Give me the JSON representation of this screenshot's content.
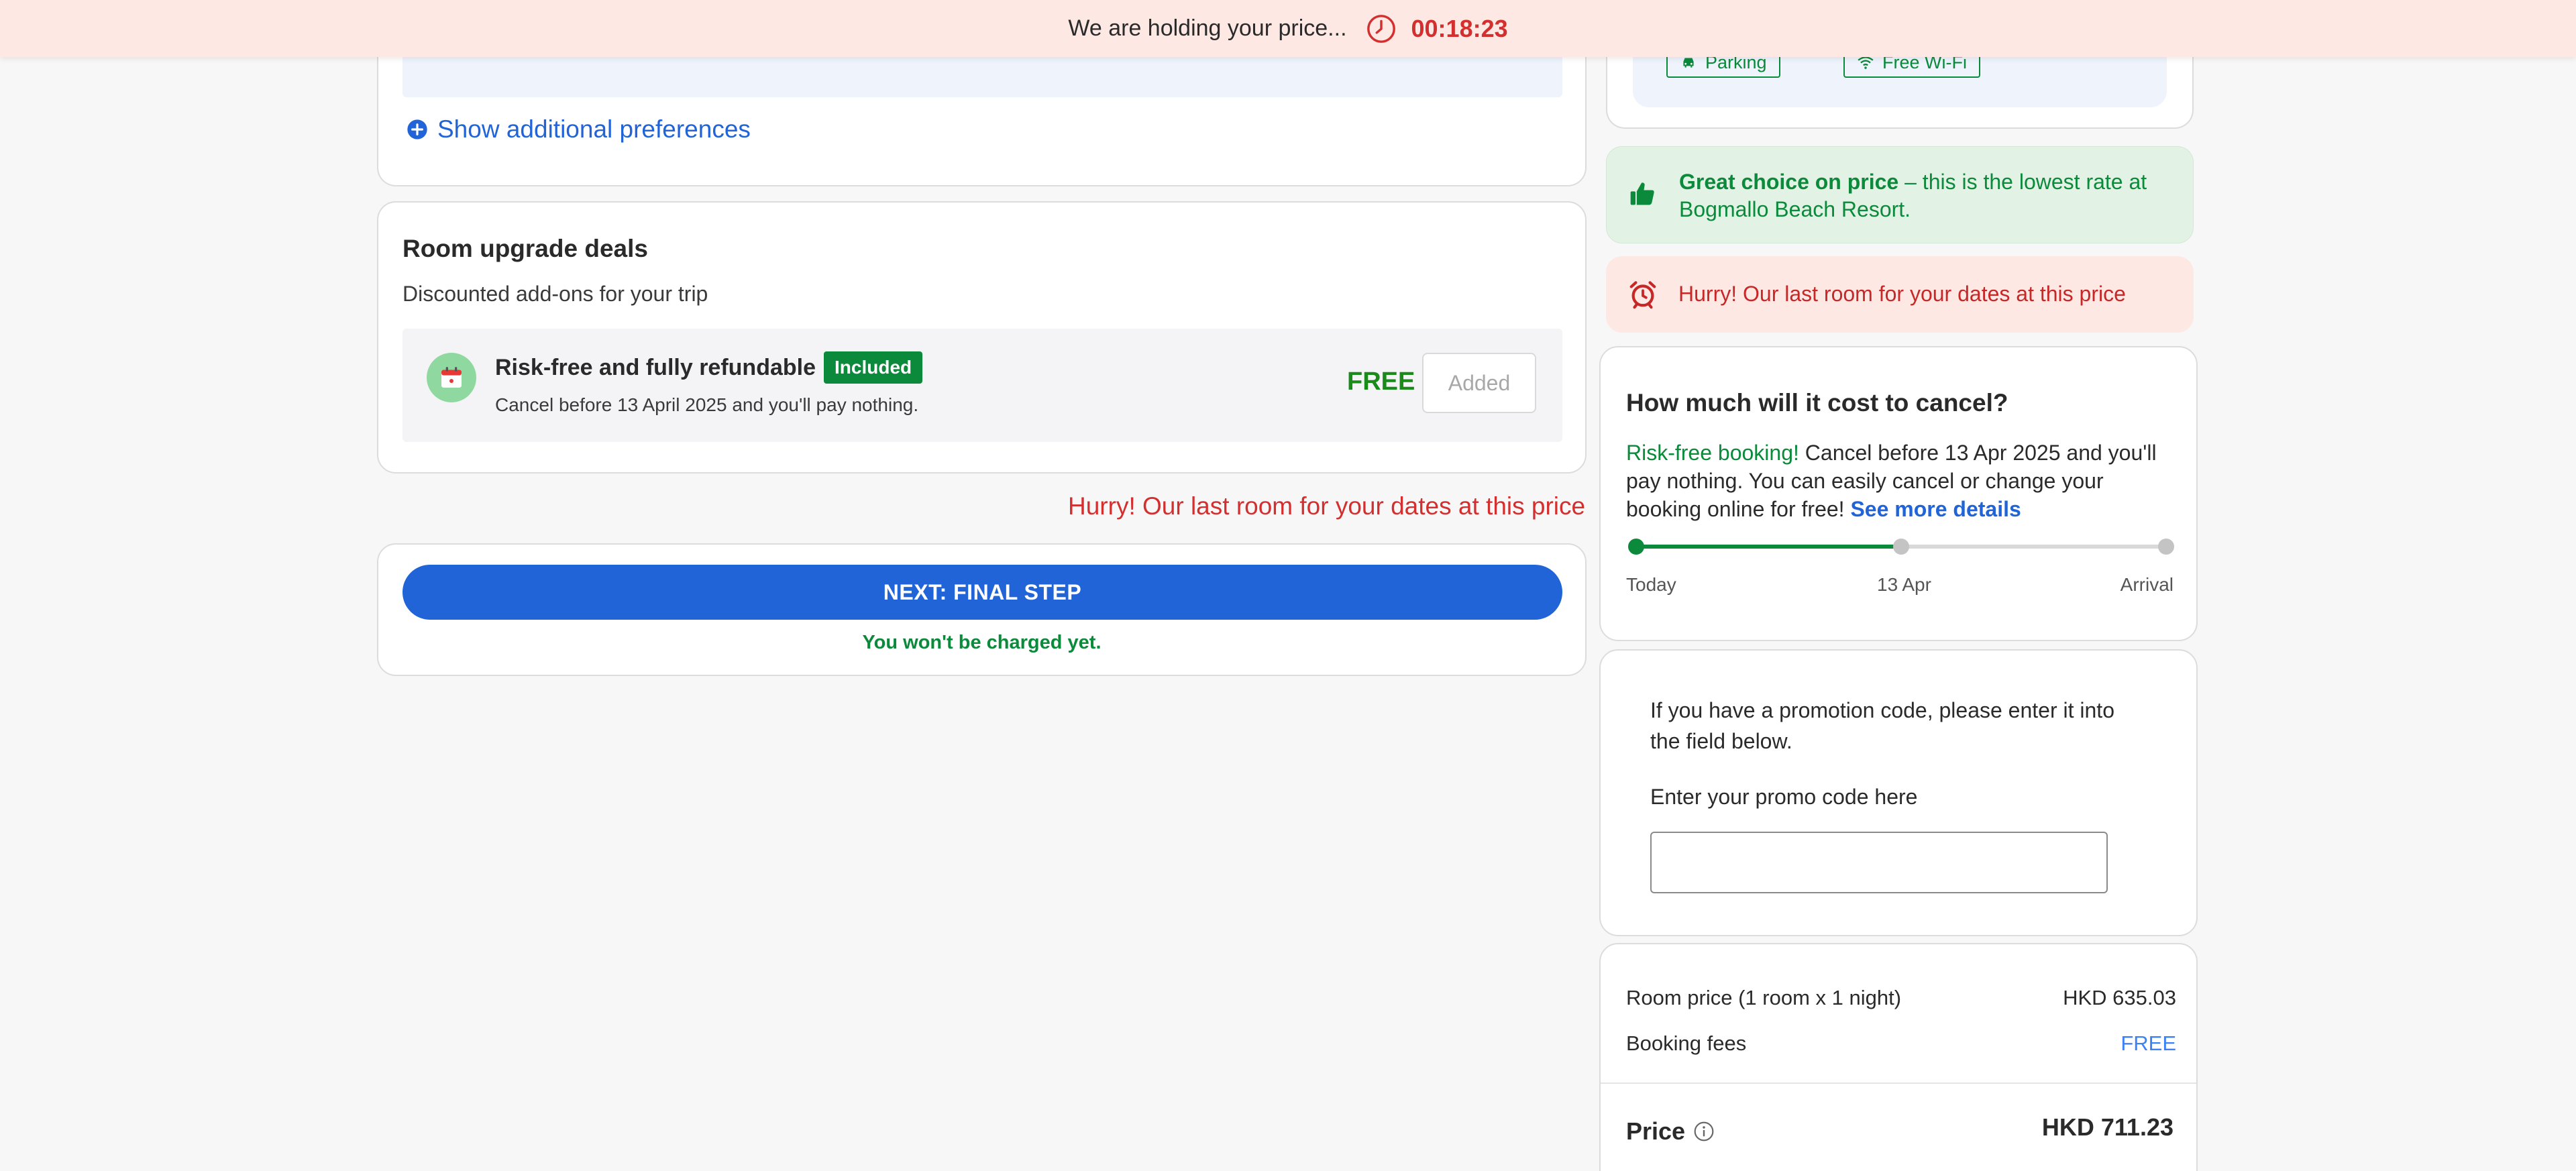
{
  "timer_bar": {
    "holding_text": "We are holding your price...",
    "countdown": "00:18:23"
  },
  "preferences": {
    "show_more_label": "Show additional preferences"
  },
  "upgrades": {
    "title": "Room upgrade deals",
    "subtitle": "Discounted add-ons for your trip",
    "item": {
      "title": "Risk-free and fully refundable",
      "badge": "Included",
      "description": "Cancel before 13 April 2025 and you'll pay nothing.",
      "price": "FREE",
      "button_label": "Added"
    }
  },
  "hurry_message": "Hurry! Our last room for your dates at this price",
  "next": {
    "button_label": "NEXT: FINAL STEP",
    "note": "You won't be charged yet."
  },
  "amenities": [
    "Parking",
    "Free Wi-Fi"
  ],
  "great_choice": {
    "bold": "Great choice on price",
    "text": " – this is the lowest rate at Bogmallo Beach Resort."
  },
  "cancellation": {
    "title": "How much will it cost to cancel?",
    "highlight": "Risk-free booking!",
    "text": " Cancel before 13 Apr 2025 and you'll pay nothing. You can easily cancel or change your booking online for free! ",
    "link": "See more details",
    "timeline": {
      "labels": [
        "Today",
        "13 Apr",
        "Arrival"
      ],
      "progress": 0.5
    }
  },
  "promo": {
    "text": "If you have a promotion code, please enter it into the field below.",
    "label": "Enter your promo code here",
    "value": ""
  },
  "pricing": {
    "room_label": "Room price (1 room x 1 night)",
    "room_value": "HKD 635.03",
    "fees_label": "Booking fees",
    "fees_value": "FREE",
    "total_label": "Price",
    "total_value": "HKD 711.23"
  },
  "colors": {
    "accent_blue": "#2164d8",
    "success_green": "#0a8a3a",
    "urgent_red": "#d32f2f"
  }
}
